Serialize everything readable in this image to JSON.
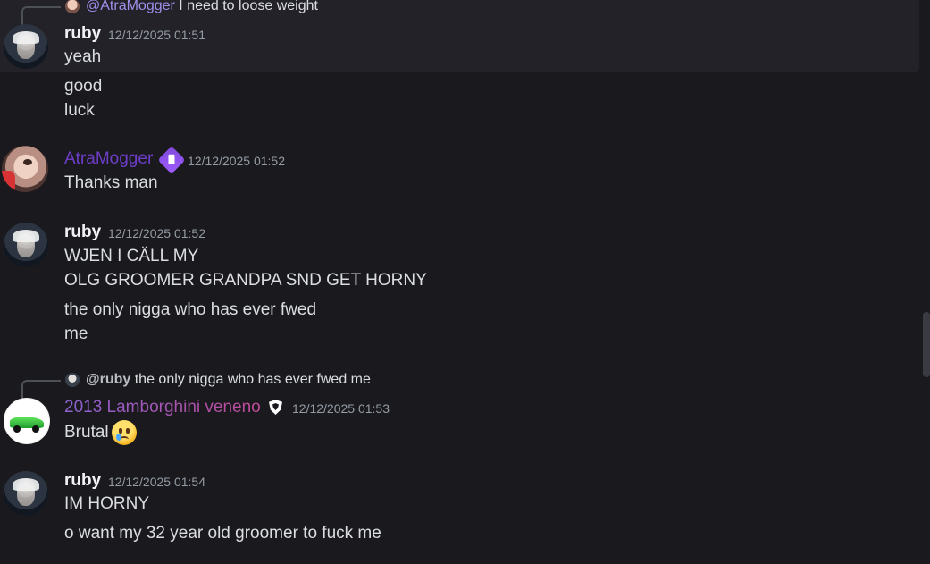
{
  "messages": [
    {
      "reply": {
        "mention": "@AtraMogger",
        "text": "I need to loose weight"
      },
      "author": "ruby",
      "timestamp": "12/12/2025 01:51",
      "lines": [
        "yeah",
        "good",
        "luck"
      ]
    },
    {
      "author": "AtraMogger",
      "timestamp": "12/12/2025 01:52",
      "lines": [
        "Thanks man"
      ]
    },
    {
      "author": "ruby",
      "timestamp": "12/12/2025 01:52",
      "lines": [
        "WJEN I CÄLL MY",
        "OLG GROOMER GRANDPA SND GET HORNY",
        "the only nigga who has ever fwed",
        "me"
      ]
    },
    {
      "reply": {
        "mention": "@ruby",
        "text": "the only nigga who has ever fwed me"
      },
      "author": "2013 Lamborghini veneno",
      "timestamp": "12/12/2025 01:53",
      "lines": [
        "Brutal"
      ]
    },
    {
      "author": "ruby",
      "timestamp": "12/12/2025 01:54",
      "lines": [
        "IM HORNY",
        "o want my 32 year old groomer to fuck me"
      ]
    }
  ],
  "icons": {
    "ruby_avatar": "avatar-icon",
    "atra_avatar": "avatar-icon",
    "lambo_avatar": "car-avatar-icon",
    "moderator_badge": "hammer-badge-icon",
    "shield_badge": "shield-icon",
    "emoji": "crying-face-icon"
  },
  "colors": {
    "background": "#1a1a1e",
    "highlight": "#222228",
    "text": "#dbdee1",
    "timestamp": "#949ba4",
    "atra_name": "#6d3dc8"
  }
}
